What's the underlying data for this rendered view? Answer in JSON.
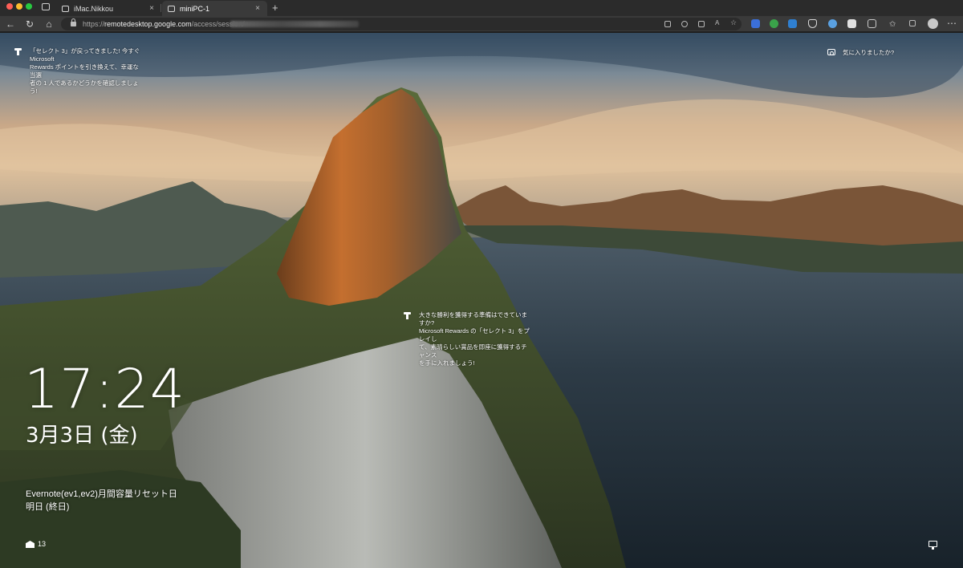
{
  "browser": {
    "tabs": [
      {
        "title": "iMac.Nikkou",
        "active": false,
        "close": "×"
      },
      {
        "title": "miniPC-1",
        "active": true,
        "close": "×"
      }
    ],
    "new_tab": "+",
    "nav": {
      "back": "←",
      "reload": "↻",
      "home": "⌂"
    },
    "url_scheme": "https://",
    "url_host": "remotedesktop.google.com",
    "url_path": "/access/session/",
    "extension_colors": [
      "#3b6fd8",
      "#3aa34a",
      "#2f7fd0",
      "#d8d8d8",
      "#5aa0e0",
      "#e0e0e0",
      "#c8c8c8"
    ],
    "menu": "⋯"
  },
  "lockscreen": {
    "tip_top": "「セレクト 3」が戻ってきました! 今すぐ Microsoft\nRewards ポイントを引き換えて、幸運な当選\n者の 1 人であるかどうかを確認しましょう!",
    "like_prompt": "気に入りましたか?",
    "tip_mid": "大きな勝利を獲得する準備はできていますか?\nMicrosoft Rewards の「セレクト 3」をプレイし\nて、素晴らしい賞品を即座に獲得するチャンス\nを手に入れましょう!",
    "time": "17:24",
    "date": "3月3日 (金)",
    "event_title": "Evernote(ev1,ev2)月間容量リセット日",
    "event_time": "明日 (終日)",
    "mail_count": "13"
  }
}
